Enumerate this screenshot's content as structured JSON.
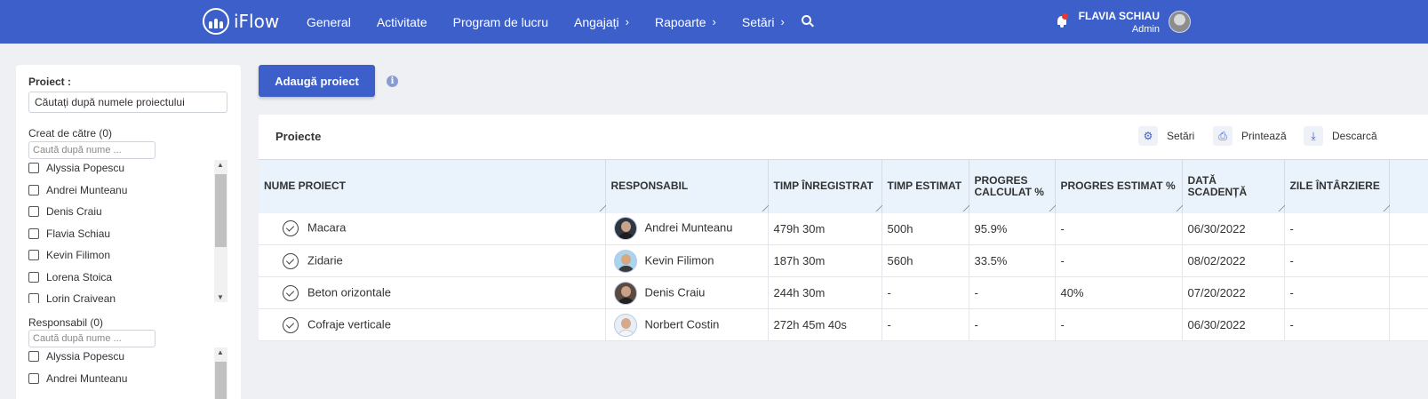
{
  "header": {
    "logo_text": "iFlow",
    "nav": [
      {
        "label": "General",
        "has_chevron": false
      },
      {
        "label": "Activitate",
        "has_chevron": false
      },
      {
        "label": "Program de lucru",
        "has_chevron": false
      },
      {
        "label": "Angajați",
        "has_chevron": true
      },
      {
        "label": "Rapoarte",
        "has_chevron": true
      },
      {
        "label": "Setări",
        "has_chevron": true
      }
    ],
    "chevron": "›",
    "user_name": "FLAVIA SCHIAU",
    "user_role": "Admin"
  },
  "filter": {
    "project_label": "Proiect :",
    "project_value": "Căutați după numele proiectului",
    "created_by_label": "Creat de către (0)",
    "created_by_search_placeholder": "Caută după nume ...",
    "created_by_items": [
      "Alyssia Popescu",
      "Andrei Munteanu",
      "Denis Craiu",
      "Flavia Schiau",
      "Kevin Filimon",
      "Lorena Stoica",
      "Lorin Craivean"
    ],
    "responsible_label": "Responsabil (0)",
    "responsible_search_placeholder": "Caută după nume ...",
    "responsible_items": [
      "Alyssia Popescu",
      "Andrei Munteanu"
    ]
  },
  "main": {
    "add_button": "Adaugă proiect",
    "card_title": "Proiecte",
    "tools": {
      "settings": "Setări",
      "print": "Printează",
      "download": "Descarcă"
    },
    "columns": [
      "NUME PROIECT",
      "RESPONSABIL",
      "TIMP ÎNREGISTRAT",
      "TIMP ESTIMAT",
      "PROGRES CALCULAT %",
      "PROGRES ESTIMAT %",
      "DATĂ SCADENȚĂ",
      "ZILE ÎNTÂRZIERE"
    ],
    "rows": [
      {
        "name": "Macara",
        "responsible": "Andrei Munteanu",
        "time_logged": "479h 30m",
        "time_estimated": "500h",
        "progress_calc": "95.9%",
        "progress_est": "-",
        "due_date": "06/30/2022",
        "delay_days": "-"
      },
      {
        "name": "Zidarie",
        "responsible": "Kevin Filimon",
        "time_logged": "187h 30m",
        "time_estimated": "560h",
        "progress_calc": "33.5%",
        "progress_est": "-",
        "due_date": "08/02/2022",
        "delay_days": "-"
      },
      {
        "name": "Beton orizontale",
        "responsible": "Denis Craiu",
        "time_logged": "244h 30m",
        "time_estimated": "-",
        "progress_calc": "-",
        "progress_est": "40%",
        "due_date": "07/20/2022",
        "delay_days": "-"
      },
      {
        "name": "Cofraje verticale",
        "responsible": "Norbert Costin",
        "time_logged": "272h 45m 40s",
        "time_estimated": "-",
        "progress_calc": "-",
        "progress_est": "-",
        "due_date": "06/30/2022",
        "delay_days": "-"
      }
    ]
  },
  "colors": {
    "primary": "#3d5fc9",
    "header_bg": "#eaf3fb",
    "page_bg": "#eef0f3",
    "notification": "#e53935"
  }
}
